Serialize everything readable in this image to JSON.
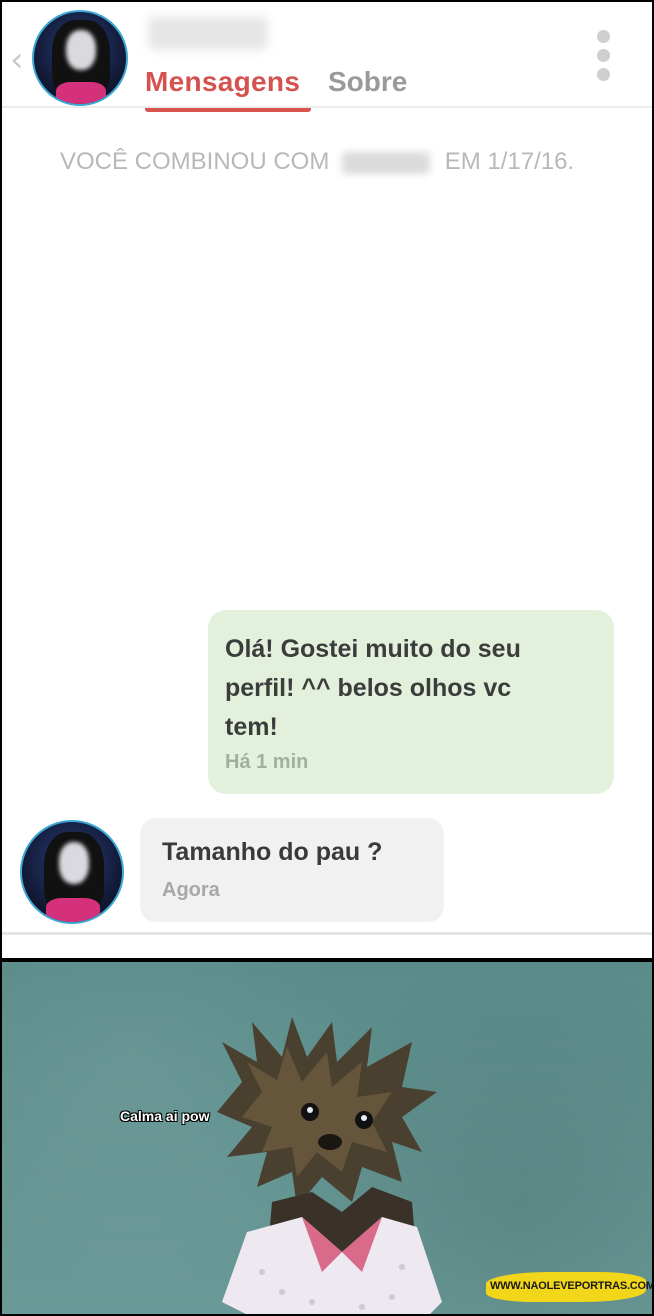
{
  "header": {
    "back_icon": "chevron-left-icon",
    "tabs": [
      {
        "label": "Mensagens",
        "active": true
      },
      {
        "label": "Sobre",
        "active": false
      }
    ],
    "more_icon": "more-vertical-icon"
  },
  "conversation": {
    "match_prefix": "VOCÊ COMBINOU COM",
    "match_suffix": "EM 1/17/16.",
    "sent": {
      "text": "Olá! Gostei muito do seu perfil! ^^ belos olhos vc tem!",
      "line1": "Olá! Gostei muito do seu",
      "line2": "perfil! ^^ belos olhos vc",
      "line3": "tem!",
      "time": "Há 1 min"
    },
    "received": {
      "text": "Tamanho do pau ?",
      "time": "Agora"
    }
  },
  "meme": {
    "caption": "Calma ai pow",
    "watermark": "WWW.NAOLEVEPORTRAS.COM"
  },
  "colors": {
    "accent": "#d4534e",
    "sent_bubble": "#e3f1dc",
    "received_bubble": "#f1f1f1",
    "meme_bg": "#5f9290"
  }
}
